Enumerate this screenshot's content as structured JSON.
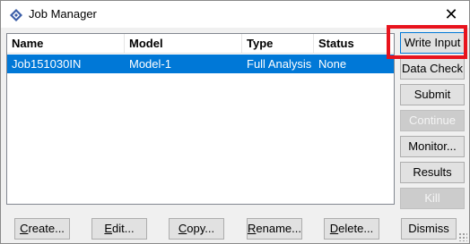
{
  "window": {
    "title": "Job Manager",
    "close_glyph": "✕",
    "icon": "abaqus-diamond-icon"
  },
  "table": {
    "columns": [
      "Name",
      "Model",
      "Type",
      "Status"
    ],
    "rows": [
      {
        "name": "Job151030IN",
        "model": "Model-1",
        "type": "Full Analysis",
        "status": "None",
        "selected": true
      }
    ]
  },
  "side_buttons": [
    {
      "label": "Write Input",
      "enabled": true,
      "focused": true
    },
    {
      "label": "Data Check",
      "enabled": true
    },
    {
      "label": "Submit",
      "enabled": true
    },
    {
      "label": "Continue",
      "enabled": false
    },
    {
      "label": "Monitor...",
      "enabled": true
    },
    {
      "label": "Results",
      "enabled": true
    },
    {
      "label": "Kill",
      "enabled": false
    }
  ],
  "bottom_buttons": [
    {
      "label": "Create...",
      "underline_index": 0
    },
    {
      "label": "Edit...",
      "underline_index": 0
    },
    {
      "label": "Copy...",
      "underline_index": 0
    },
    {
      "label": "Rename...",
      "underline_index": 0
    },
    {
      "label": "Delete...",
      "underline_index": 0
    },
    {
      "label": "Dismiss",
      "underline_index": null
    }
  ],
  "colors": {
    "selection": "#0078d7",
    "highlight_box": "#e8131d"
  }
}
